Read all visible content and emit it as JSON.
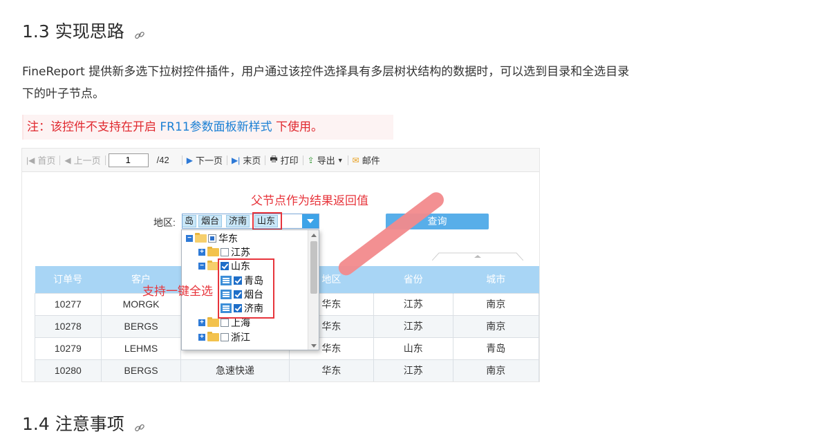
{
  "headings": {
    "h13": "1.3 实现思路",
    "h14": "1.4 注意事项"
  },
  "paragraph": {
    "line1": "FineReport 提供新多选下拉树控件插件，用户通过该控件选择具有多层树状结构的数据时，可以选到目录和全选目录",
    "line2": "下的叶子节点。"
  },
  "note": {
    "prefix": "注：该控件不支持在开启 ",
    "link": "FR11参数面板新样式",
    "suffix": " 下使用。"
  },
  "toolbar": {
    "first": "首页",
    "prev": "上一页",
    "page": "1",
    "total": "/42",
    "next": "下一页",
    "last": "末页",
    "print": "打印",
    "export": "导出",
    "mail": "邮件"
  },
  "annotations": {
    "parent": "父节点作为结果返回值",
    "select_all": "支持一键全选"
  },
  "params": {
    "region_label": "地区:",
    "chips": [
      "岛",
      "烟台",
      "济南",
      "山东"
    ],
    "query": "查询"
  },
  "tree": [
    {
      "label": "华东"
    },
    {
      "label": "江苏"
    },
    {
      "label": "山东"
    },
    {
      "label": "青岛"
    },
    {
      "label": "烟台"
    },
    {
      "label": "济南"
    },
    {
      "label": "上海"
    },
    {
      "label": "浙江"
    }
  ],
  "table": {
    "headers": [
      "订单号",
      "客户",
      "",
      "地区",
      "省份",
      "城市"
    ],
    "rows": [
      [
        "10277",
        "MORGK",
        "",
        "华东",
        "江苏",
        "南京"
      ],
      [
        "10278",
        "BERGS",
        "",
        "华东",
        "江苏",
        "南京"
      ],
      [
        "10279",
        "LEHMS",
        "",
        "华东",
        "山东",
        "青岛"
      ],
      [
        "10280",
        "BERGS",
        "急速快递",
        "华东",
        "江苏",
        "南京"
      ]
    ]
  },
  "colors": {
    "accent": "#3da3e8",
    "annotation": "#e7343b",
    "header_bg": "#a8d5f5"
  }
}
